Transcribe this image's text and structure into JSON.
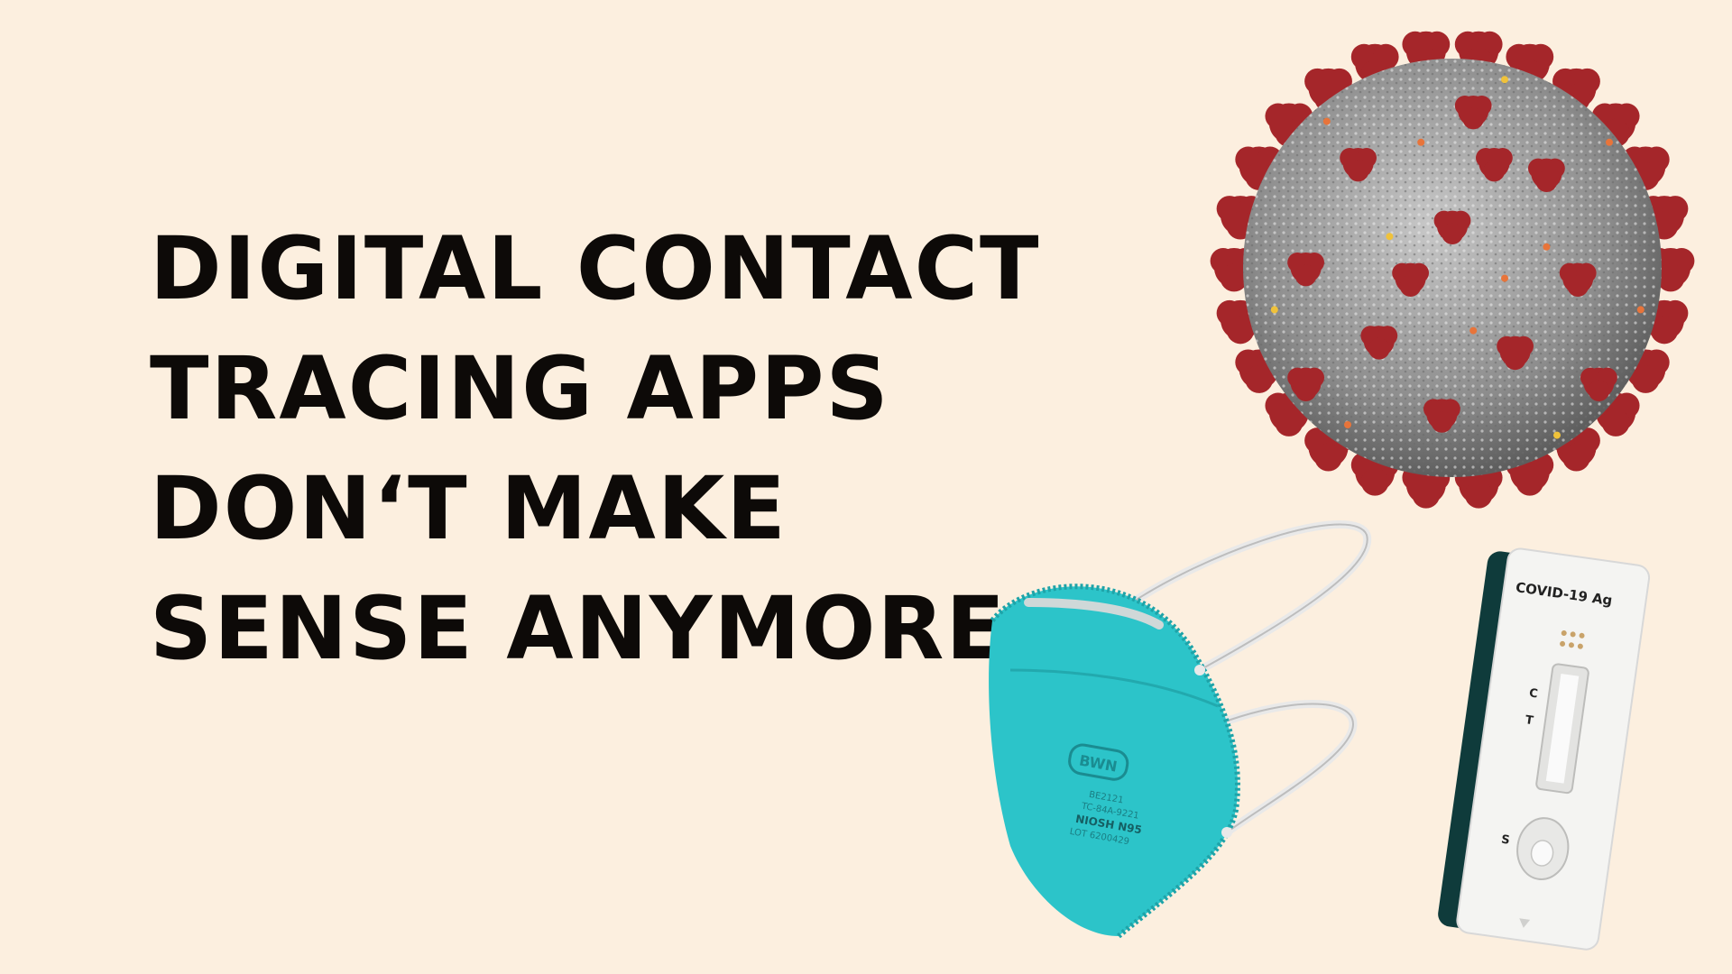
{
  "headline": {
    "lines": [
      "DIGITAL CONTACT",
      "TRACING APPS",
      "DON‘T MAKE",
      "SENSE ANYMORE"
    ]
  },
  "test_kit": {
    "brand_label": "COVID-19 Ag",
    "control_mark": "C",
    "test_mark": "T",
    "sample_mark": "S"
  },
  "mask": {
    "logo_text": "BWN",
    "print_lines": [
      "BE2121",
      "TC-84A-9221",
      "NIOSH  N95",
      "LOT 6200429"
    ]
  },
  "colors": {
    "background": "#fcefdf",
    "headline": "#0d0a08",
    "virus_spike": "#a5262a",
    "virus_body": "#9a9a9a",
    "mask": "#2cc4c9",
    "cassette_dark": "#0f3b3b"
  }
}
